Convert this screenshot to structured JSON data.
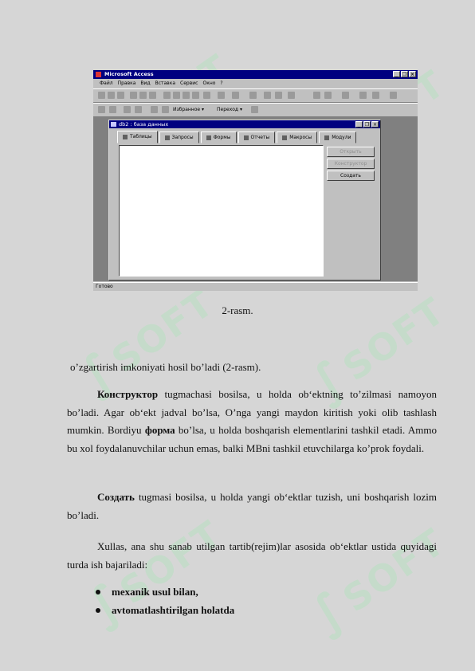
{
  "figure": {
    "app_title": "Microsoft Access",
    "menu": [
      "Файл",
      "Правка",
      "Вид",
      "Вставка",
      "Сервис",
      "Окно",
      "?"
    ],
    "toolbar2": {
      "favorites": "Избранное ▾",
      "goto": "Переход ▾"
    },
    "db_window": {
      "title": "db2 : база данных",
      "tabs": [
        "Таблицы",
        "Запросы",
        "Формы",
        "Отчеты",
        "Макросы",
        "Модули"
      ],
      "buttons": [
        "Открыть",
        "Конструктор",
        "Создать"
      ]
    },
    "status": "Готово",
    "window_buttons": [
      "_",
      "❐",
      "×"
    ]
  },
  "caption": "2-rasm.",
  "paragraphs": {
    "p0": "o’zgartirish imkoniyati hosil bo’ladi (2-rasm).",
    "p1_bold": "Конструктор",
    "p1_a": "  tugmachasi bosilsa, u holda ob‘ektning to’zilmasi namoyon bo’ladi. Agar ob‘ekt jadval bo’lsa, O’nga yangi maydon kiritish yoki olib tashlash mumkin. Bordiyu ",
    "p1_bold2": "форма",
    "p1_b": " bo’lsa, u holda boshqarish elementlarini tashkil etadi. Ammo bu xol foydalanuvchilar uchun emas, balki MBni tashkil etuvchilarga ko’prok foydali.",
    "p2_bold": "Создать",
    "p2": " tugmasi bosilsa, u holda yangi ob‘ektlar tuzish, uni boshqarish lozim bo’ladi.",
    "p3": "Xullas, ana shu sanab utilgan  tartib(rejim)lar asosida  ob‘ektlar ustida quyidagi turda ish bajariladi:"
  },
  "bullets": [
    "mexanik usul bilan,",
    "avtomatlashtirilgan holatda"
  ],
  "watermark": {
    "text": "SOFT",
    "color": "#b8e0c2"
  }
}
